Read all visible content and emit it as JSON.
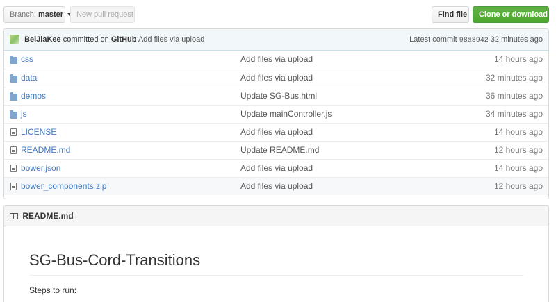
{
  "toolbar": {
    "branch_prefix": "Branch:",
    "branch_name": "master",
    "new_pr_label": "New pull request",
    "find_file_label": "Find file",
    "clone_label": "Clone or download"
  },
  "commit": {
    "author": "BeiJiaKee",
    "committed_on": "committed on",
    "platform": "GitHub",
    "message": "Add files via upload",
    "latest_label": "Latest commit",
    "sha": "98a8942",
    "age": "32 minutes ago"
  },
  "files": [
    {
      "type": "dir",
      "name": "css",
      "message": "Add files via upload",
      "age": "14 hours ago"
    },
    {
      "type": "dir",
      "name": "data",
      "message": "Add files via upload",
      "age": "32 minutes ago"
    },
    {
      "type": "dir",
      "name": "demos",
      "message": "Update SG-Bus.html",
      "age": "36 minutes ago"
    },
    {
      "type": "dir",
      "name": "js",
      "message": "Update mainController.js",
      "age": "34 minutes ago"
    },
    {
      "type": "file",
      "name": "LICENSE",
      "message": "Add files via upload",
      "age": "14 hours ago"
    },
    {
      "type": "file",
      "name": "README.md",
      "message": "Update README.md",
      "age": "12 hours ago"
    },
    {
      "type": "file",
      "name": "bower.json",
      "message": "Add files via upload",
      "age": "14 hours ago"
    },
    {
      "type": "file",
      "name": "bower_components.zip",
      "message": "Add files via upload",
      "age": "12 hours ago"
    }
  ],
  "readme": {
    "header": "README.md",
    "title": "SG-Bus-Cord-Transitions",
    "intro": "Steps to run:"
  },
  "colors": {
    "link": "#4078c0",
    "clone_button": "#55a532",
    "commit_bar": "#f2f8fa"
  }
}
